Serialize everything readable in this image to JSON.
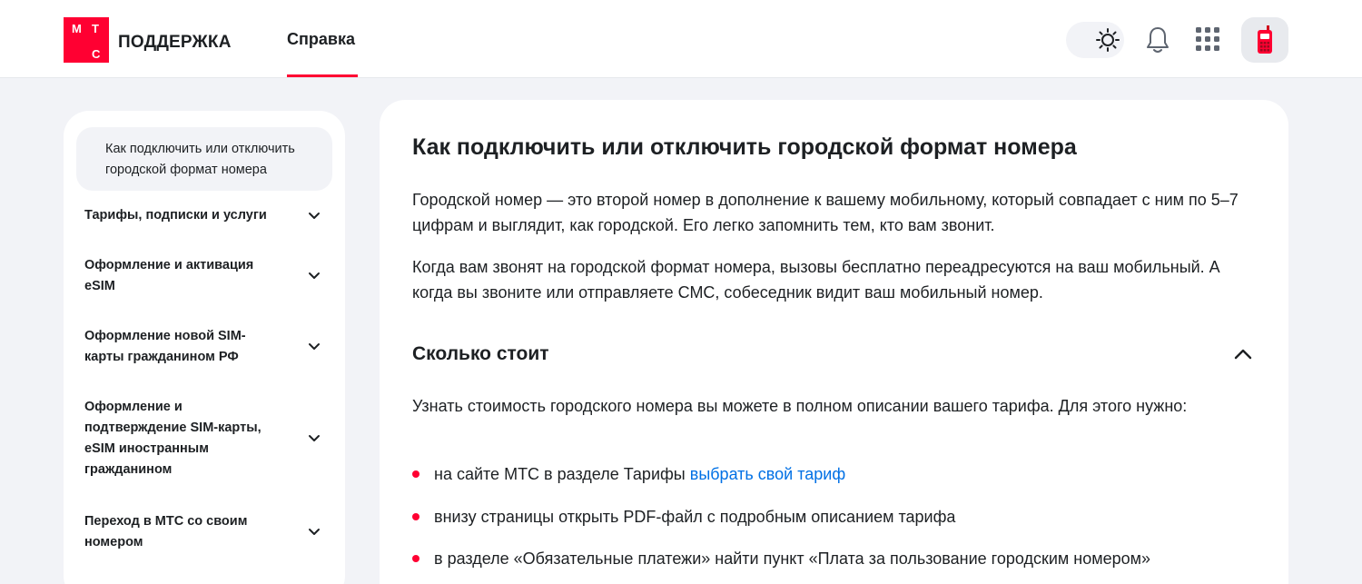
{
  "header": {
    "logo_letters": [
      "М",
      "Т",
      "С"
    ],
    "brand": "ПОДДЕРЖКА",
    "nav_help": "Справка",
    "accent": "#ff0032"
  },
  "sidebar": {
    "active_item": "Как подключить или отключить городской формат номера",
    "items": [
      {
        "label": "Тарифы, подписки и услуги"
      },
      {
        "label": "Оформление и активация eSIM"
      },
      {
        "label": "Оформление новой SIM-карты гражданином РФ"
      },
      {
        "label": "Оформление и подтверждение SIM-карты, eSIM иностранным гражданином"
      },
      {
        "label": "Переход в МТС со своим номером"
      }
    ]
  },
  "article": {
    "title": "Как подключить или отключить городской формат номера",
    "paragraphs": [
      "Городской номер — это второй номер в дополнение к вашему мобильному, который совпадает с ним по 5–7 цифрам и выглядит, как городской. Его легко запомнить тем, кто вам звонит.",
      "Когда вам звонят на городской формат номера, вызовы бесплатно переадресуются на ваш мобильный. А когда вы звоните или отправляете СМС, собеседник видит ваш мобильный номер."
    ],
    "section_title": "Сколько стоит",
    "section_intro": "Узнать стоимость городского номера вы можете в полном описании вашего тарифа. Для этого нужно:",
    "bullets": [
      {
        "text": "на сайте МТС в разделе Тарифы ",
        "link": "выбрать свой тариф"
      },
      {
        "text": "внизу страницы открыть PDF-файл с подробным описанием тарифа"
      },
      {
        "text": "в разделе «Обязательные платежи» найти пункт «Плата за пользование городским номером»"
      }
    ],
    "link_color": "#0070e5"
  }
}
